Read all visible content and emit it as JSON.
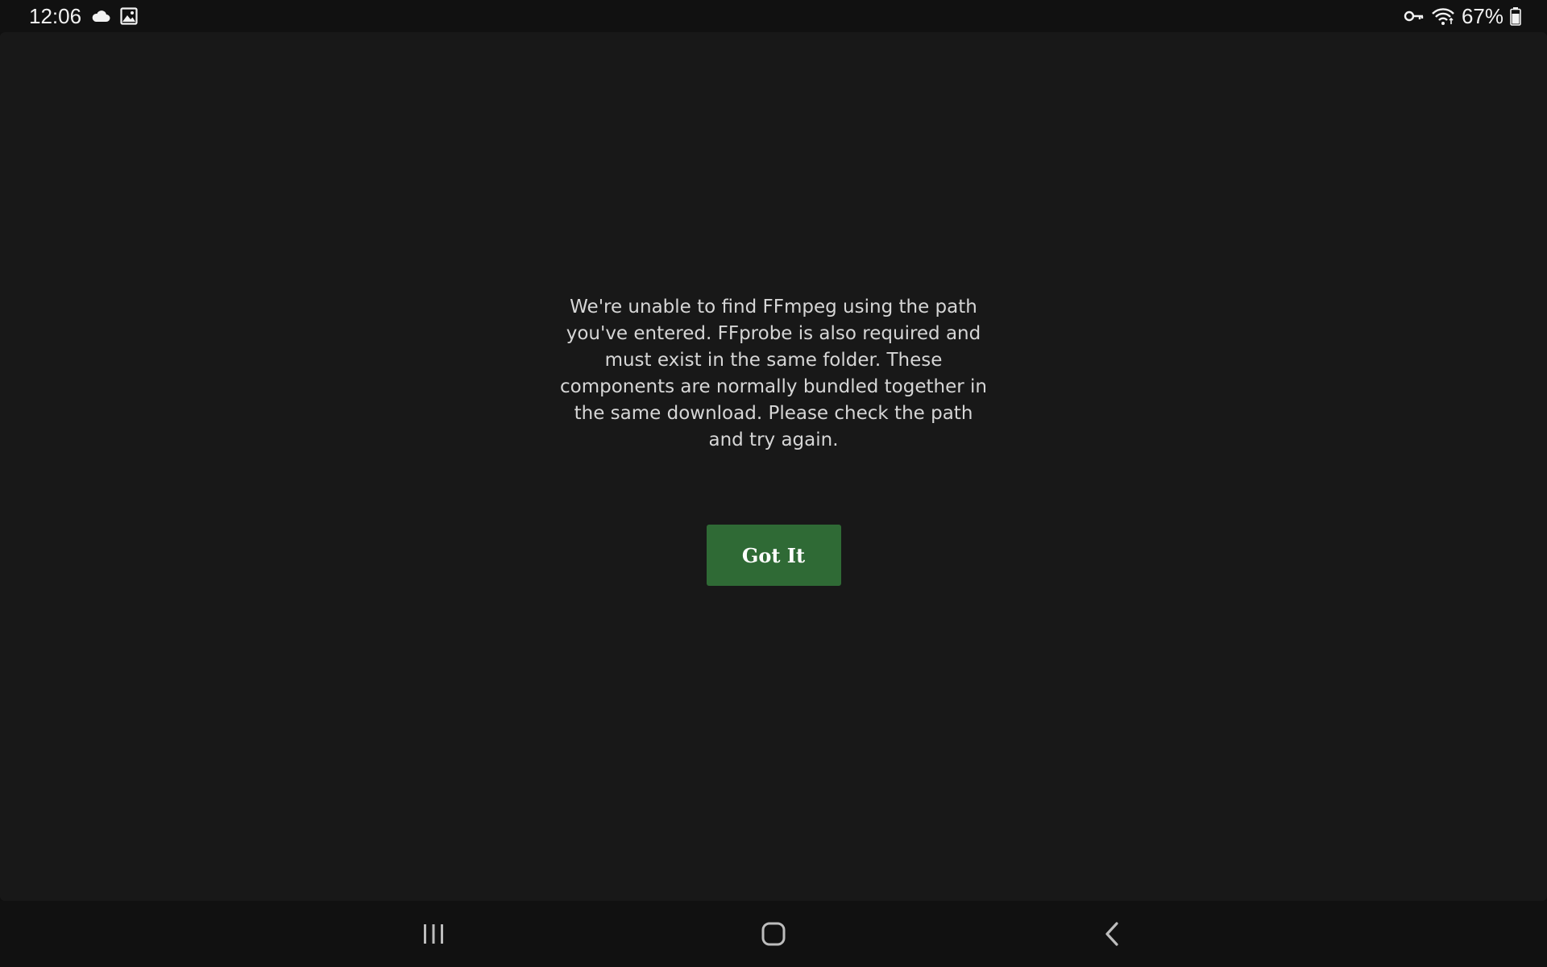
{
  "status_bar": {
    "time": "12:06",
    "battery": "67%",
    "icons": [
      "cloud-icon",
      "image-icon",
      "vpn-key-icon",
      "wifi-icon",
      "battery-icon"
    ]
  },
  "dialog": {
    "message": "We're unable to find FFmpeg using the path you've entered. FFprobe is also required and must exist in the same folder. These components are normally bundled together in the same download. Please check the path and try again.",
    "button_label": "Got It"
  },
  "colors": {
    "background": "#181818",
    "button": "#2f6a35",
    "text": "#d6d6d6"
  },
  "nav_bar": {
    "icons": [
      "recents-icon",
      "home-icon",
      "back-icon"
    ]
  }
}
